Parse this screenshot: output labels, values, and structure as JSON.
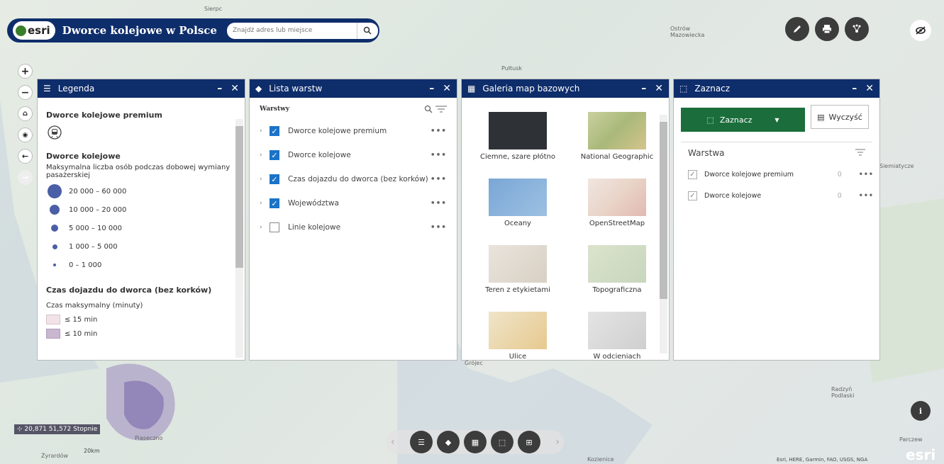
{
  "header": {
    "logo_text": "esri",
    "title": "Dworce kolejowe w Polsce",
    "search_placeholder": "Znajdź adres lub miejsce"
  },
  "map_labels": [
    "Sierpc",
    "Pułtusk",
    "Ostrów Mazowiecka",
    "Siemiatycze",
    "Radzyń Podlaski",
    "Parczew",
    "Kozienice",
    "Żyrardów",
    "Piaseczno",
    "Grójec"
  ],
  "coordinates": "20,871 51,572 Stopnie",
  "scale": "20km",
  "attribution": "Esri, HERE, Garmin, FAO, USGS, NGA",
  "legend": {
    "title": "Legenda",
    "h1": "Dworce kolejowe premium",
    "h2": "Dworce kolejowe",
    "desc": "Maksymalna liczba osób podczas dobowej wymiany pasażerskiej",
    "items": [
      {
        "label": "20 000 – 60 000"
      },
      {
        "label": "10 000 – 20 000"
      },
      {
        "label": "5 000 – 10 000"
      },
      {
        "label": "1 000 – 5 000"
      },
      {
        "label": "0 – 1 000"
      }
    ],
    "h3": "Czas dojazdu do dworca (bez korków)",
    "t3": "Czas maksymalny (minuty)",
    "items2": [
      {
        "label": "≤ 15 min"
      },
      {
        "label": "≤ 10 min"
      }
    ]
  },
  "layers": {
    "title": "Lista warstw",
    "subtitle": "Warstwy",
    "items": [
      {
        "label": "Dworce kolejowe premium",
        "checked": true
      },
      {
        "label": "Dworce kolejowe",
        "checked": true
      },
      {
        "label": "Czas dojazdu do dworca (bez korków)",
        "checked": true
      },
      {
        "label": "Województwa",
        "checked": true
      },
      {
        "label": "Linie kolejowe",
        "checked": false
      }
    ]
  },
  "basemaps": {
    "title": "Galeria map bazowych",
    "items": [
      {
        "label": "Ciemne, szare płótno"
      },
      {
        "label": "National Geographic"
      },
      {
        "label": "Oceany"
      },
      {
        "label": "OpenStreetMap"
      },
      {
        "label": "Teren z etykietami"
      },
      {
        "label": "Topograficzna"
      },
      {
        "label": "Ulice"
      },
      {
        "label": "W odcieniach"
      }
    ]
  },
  "select": {
    "title": "Zaznacz",
    "select_label": "Zaznacz",
    "clear_label": "Wyczyść",
    "layer_header": "Warstwa",
    "rows": [
      {
        "label": "Dworce kolejowe premium",
        "count": "0"
      },
      {
        "label": "Dworce kolejowe",
        "count": "0"
      }
    ]
  },
  "colors": {
    "header": "#0e2d6b",
    "select_green": "#1b6e3b",
    "symbol": "#4b5fa6",
    "checkbox": "#1a73c8"
  }
}
